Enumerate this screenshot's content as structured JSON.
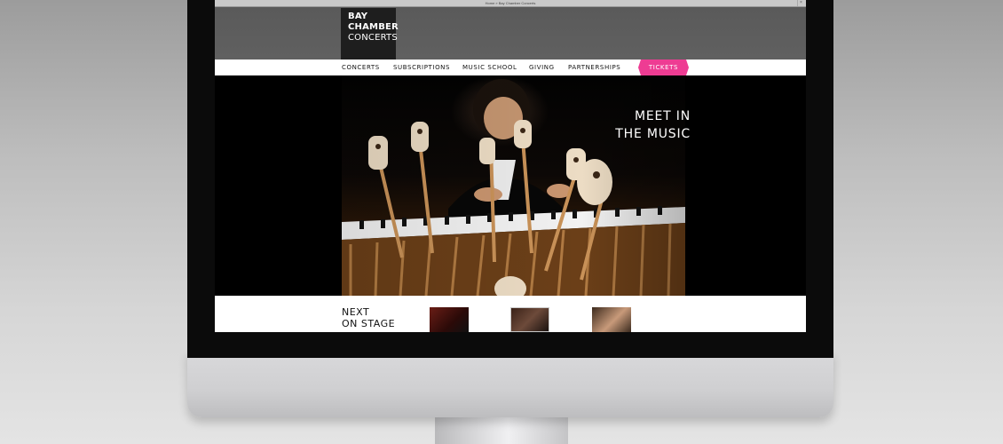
{
  "browser": {
    "address": "Home » Bay Chamber Concerts",
    "close_glyph": "×"
  },
  "logo": {
    "line1": "BAY",
    "line2": "CHAMBER",
    "line3": "CONCERTS"
  },
  "nav": {
    "items": [
      {
        "label": "CONCERTS"
      },
      {
        "label": "SUBSCRIPTIONS"
      },
      {
        "label": "MUSIC SCHOOL"
      },
      {
        "label": "GIVING"
      },
      {
        "label": "PARTNERSHIPS"
      }
    ],
    "tickets_label": "TICKETS",
    "tickets_color": "#ee3c93"
  },
  "hero": {
    "headline_line1": "MEET IN",
    "headline_line2": "THE MUSIC"
  },
  "next_on_stage": {
    "title_line1": "NEXT",
    "title_line2": "ON STAGE"
  }
}
